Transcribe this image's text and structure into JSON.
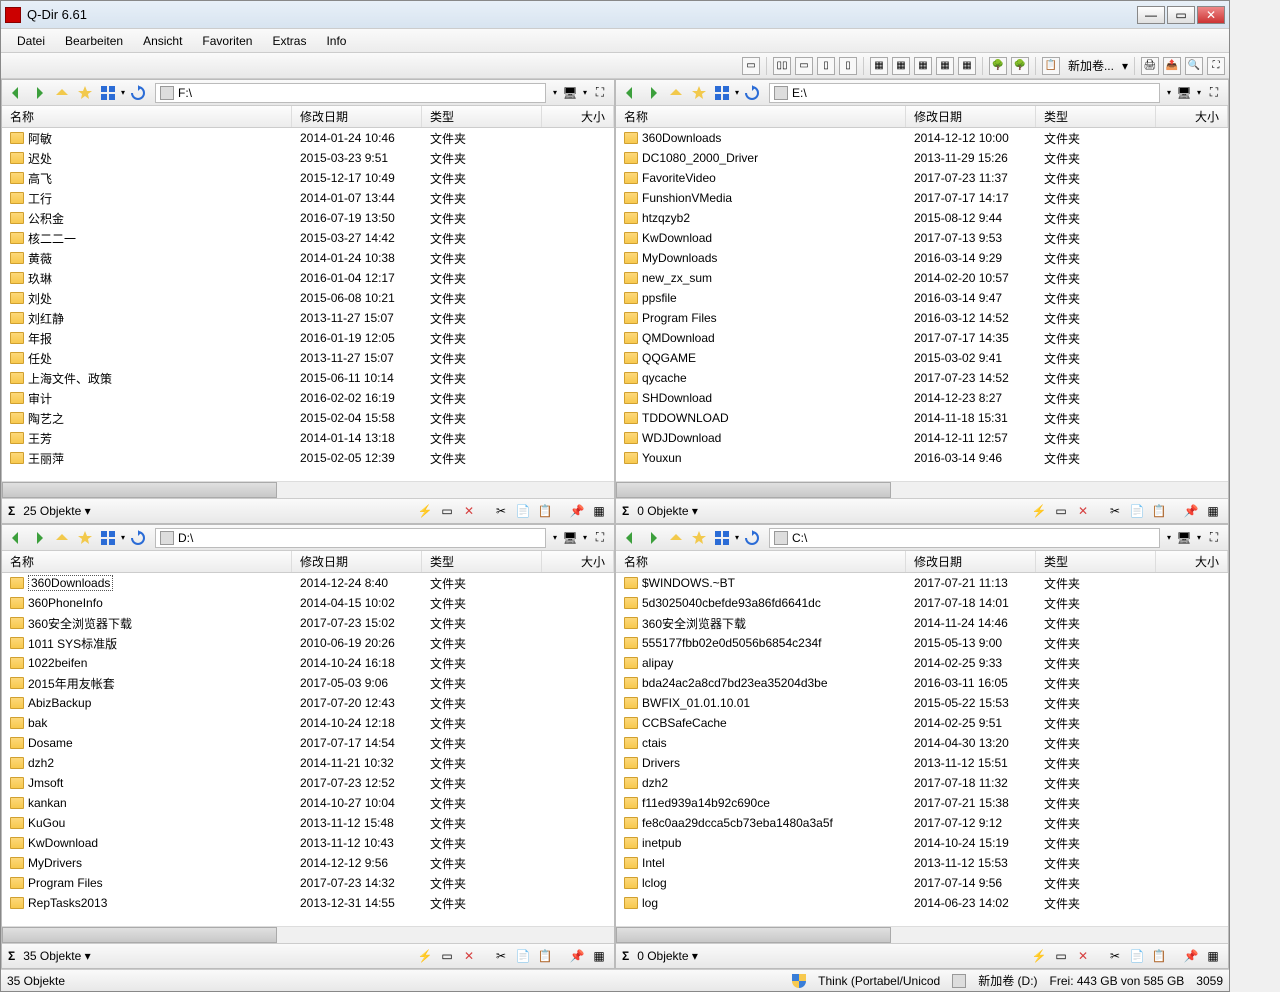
{
  "title": "Q-Dir 6.61",
  "menu": [
    "Datei",
    "Bearbeiten",
    "Ansicht",
    "Favoriten",
    "Extras",
    "Info"
  ],
  "columns": {
    "name": "名称",
    "date": "修改日期",
    "type": "类型",
    "size": "大小"
  },
  "topright_label": "新加卷...",
  "panes": {
    "tl": {
      "path": "F:\\",
      "status": "25 Objekte",
      "files": [
        {
          "name": "阿敏",
          "date": "2014-01-24 10:46",
          "type": "文件夹"
        },
        {
          "name": "迟处",
          "date": "2015-03-23 9:51",
          "type": "文件夹"
        },
        {
          "name": "高飞",
          "date": "2015-12-17 10:49",
          "type": "文件夹"
        },
        {
          "name": "工行",
          "date": "2014-01-07 13:44",
          "type": "文件夹"
        },
        {
          "name": "公积金",
          "date": "2016-07-19 13:50",
          "type": "文件夹"
        },
        {
          "name": "核二二一",
          "date": "2015-03-27 14:42",
          "type": "文件夹"
        },
        {
          "name": "黄薇",
          "date": "2014-01-24 10:38",
          "type": "文件夹"
        },
        {
          "name": "玖琳",
          "date": "2016-01-04 12:17",
          "type": "文件夹"
        },
        {
          "name": "刘处",
          "date": "2015-06-08 10:21",
          "type": "文件夹"
        },
        {
          "name": "刘红静",
          "date": "2013-11-27 15:07",
          "type": "文件夹"
        },
        {
          "name": "年报",
          "date": "2016-01-19 12:05",
          "type": "文件夹"
        },
        {
          "name": "任处",
          "date": "2013-11-27 15:07",
          "type": "文件夹"
        },
        {
          "name": "上海文件、政策",
          "date": "2015-06-11 10:14",
          "type": "文件夹"
        },
        {
          "name": "审计",
          "date": "2016-02-02 16:19",
          "type": "文件夹"
        },
        {
          "name": "陶艺之",
          "date": "2015-02-04 15:58",
          "type": "文件夹"
        },
        {
          "name": "王芳",
          "date": "2014-01-14 13:18",
          "type": "文件夹"
        },
        {
          "name": "王丽萍",
          "date": "2015-02-05 12:39",
          "type": "文件夹"
        }
      ]
    },
    "tr": {
      "path": "E:\\",
      "status": "0 Objekte",
      "files": [
        {
          "name": "360Downloads",
          "date": "2014-12-12 10:00",
          "type": "文件夹"
        },
        {
          "name": "DC1080_2000_Driver",
          "date": "2013-11-29 15:26",
          "type": "文件夹"
        },
        {
          "name": "FavoriteVideo",
          "date": "2017-07-23 11:37",
          "type": "文件夹"
        },
        {
          "name": "FunshionVMedia",
          "date": "2017-07-17 14:17",
          "type": "文件夹"
        },
        {
          "name": "htzqzyb2",
          "date": "2015-08-12 9:44",
          "type": "文件夹"
        },
        {
          "name": "KwDownload",
          "date": "2017-07-13 9:53",
          "type": "文件夹"
        },
        {
          "name": "MyDownloads",
          "date": "2016-03-14 9:29",
          "type": "文件夹"
        },
        {
          "name": "new_zx_sum",
          "date": "2014-02-20 10:57",
          "type": "文件夹"
        },
        {
          "name": "ppsfile",
          "date": "2016-03-14 9:47",
          "type": "文件夹"
        },
        {
          "name": "Program Files",
          "date": "2016-03-12 14:52",
          "type": "文件夹"
        },
        {
          "name": "QMDownload",
          "date": "2017-07-17 14:35",
          "type": "文件夹"
        },
        {
          "name": "QQGAME",
          "date": "2015-03-02 9:41",
          "type": "文件夹"
        },
        {
          "name": "qycache",
          "date": "2017-07-23 14:52",
          "type": "文件夹"
        },
        {
          "name": "SHDownload",
          "date": "2014-12-23 8:27",
          "type": "文件夹"
        },
        {
          "name": "TDDOWNLOAD",
          "date": "2014-11-18 15:31",
          "type": "文件夹"
        },
        {
          "name": "WDJDownload",
          "date": "2014-12-11 12:57",
          "type": "文件夹"
        },
        {
          "name": "Youxun",
          "date": "2016-03-14 9:46",
          "type": "文件夹"
        }
      ]
    },
    "bl": {
      "path": "D:\\",
      "status": "35 Objekte",
      "selected": 0,
      "files": [
        {
          "name": "360Downloads",
          "date": "2014-12-24 8:40",
          "type": "文件夹"
        },
        {
          "name": "360PhoneInfo",
          "date": "2014-04-15 10:02",
          "type": "文件夹"
        },
        {
          "name": "360安全浏览器下载",
          "date": "2017-07-23 15:02",
          "type": "文件夹"
        },
        {
          "name": "1011 SYS标准版",
          "date": "2010-06-19 20:26",
          "type": "文件夹"
        },
        {
          "name": "1022beifen",
          "date": "2014-10-24 16:18",
          "type": "文件夹"
        },
        {
          "name": "2015年用友帐套",
          "date": "2017-05-03 9:06",
          "type": "文件夹"
        },
        {
          "name": "AbizBackup",
          "date": "2017-07-20 12:43",
          "type": "文件夹"
        },
        {
          "name": "bak",
          "date": "2014-10-24 12:18",
          "type": "文件夹"
        },
        {
          "name": "Dosame",
          "date": "2017-07-17 14:54",
          "type": "文件夹"
        },
        {
          "name": "dzh2",
          "date": "2014-11-21 10:32",
          "type": "文件夹"
        },
        {
          "name": "Jmsoft",
          "date": "2017-07-23 12:52",
          "type": "文件夹"
        },
        {
          "name": "kankan",
          "date": "2014-10-27 10:04",
          "type": "文件夹"
        },
        {
          "name": "KuGou",
          "date": "2013-11-12 15:48",
          "type": "文件夹"
        },
        {
          "name": "KwDownload",
          "date": "2013-11-12 10:43",
          "type": "文件夹"
        },
        {
          "name": "MyDrivers",
          "date": "2014-12-12 9:56",
          "type": "文件夹"
        },
        {
          "name": "Program Files",
          "date": "2017-07-23 14:32",
          "type": "文件夹"
        },
        {
          "name": "RepTasks2013",
          "date": "2013-12-31 14:55",
          "type": "文件夹"
        }
      ]
    },
    "br": {
      "path": "C:\\",
      "status": "0 Objekte",
      "files": [
        {
          "name": "$WINDOWS.~BT",
          "date": "2017-07-21 11:13",
          "type": "文件夹"
        },
        {
          "name": "5d3025040cbefde93a86fd6641dc",
          "date": "2017-07-18 14:01",
          "type": "文件夹"
        },
        {
          "name": "360安全浏览器下载",
          "date": "2014-11-24 14:46",
          "type": "文件夹"
        },
        {
          "name": "555177fbb02e0d5056b6854c234f",
          "date": "2015-05-13 9:00",
          "type": "文件夹"
        },
        {
          "name": "alipay",
          "date": "2014-02-25 9:33",
          "type": "文件夹"
        },
        {
          "name": "bda24ac2a8cd7bd23ea35204d3be",
          "date": "2016-03-11 16:05",
          "type": "文件夹"
        },
        {
          "name": "BWFIX_01.01.10.01",
          "date": "2015-05-22 15:53",
          "type": "文件夹"
        },
        {
          "name": "CCBSafeCache",
          "date": "2014-02-25 9:51",
          "type": "文件夹"
        },
        {
          "name": "ctais",
          "date": "2014-04-30 13:20",
          "type": "文件夹"
        },
        {
          "name": "Drivers",
          "date": "2013-11-12 15:51",
          "type": "文件夹"
        },
        {
          "name": "dzh2",
          "date": "2017-07-18 11:32",
          "type": "文件夹"
        },
        {
          "name": "f11ed939a14b92c690ce",
          "date": "2017-07-21 15:38",
          "type": "文件夹"
        },
        {
          "name": "fe8c0aa29dcca5cb73eba1480a3a5f",
          "date": "2017-07-12 9:12",
          "type": "文件夹"
        },
        {
          "name": "inetpub",
          "date": "2014-10-24 15:19",
          "type": "文件夹"
        },
        {
          "name": "Intel",
          "date": "2013-11-12 15:53",
          "type": "文件夹"
        },
        {
          "name": "lclog",
          "date": "2017-07-14 9:56",
          "type": "文件夹"
        },
        {
          "name": "log",
          "date": "2014-06-23 14:02",
          "type": "文件夹"
        }
      ]
    }
  },
  "bottomStatus": {
    "left": "35 Objekte",
    "think": "Think (Portabel/Unicod",
    "drive": "新加卷 (D:)",
    "free": "Frei: 443 GB von 585 GB",
    "count": "3059"
  }
}
